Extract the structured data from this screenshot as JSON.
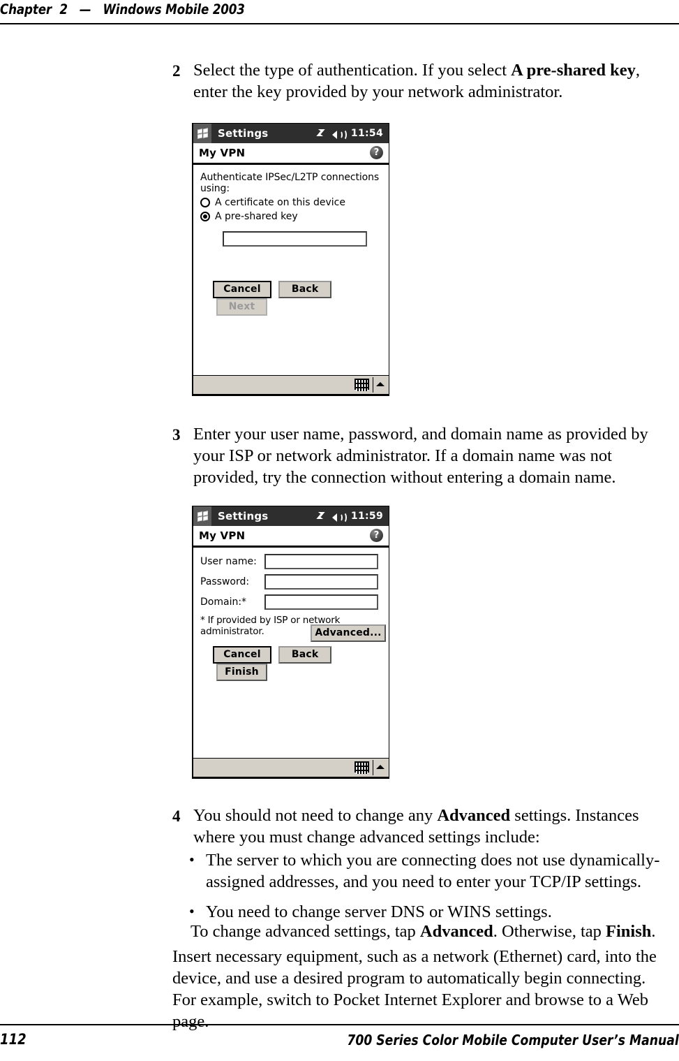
{
  "header": {
    "text": "Chapter  2   —   Windows Mobile 2003"
  },
  "footer": {
    "page_number": "112",
    "manual_title": "700 Series Color Mobile Computer User’s Manual"
  },
  "steps": {
    "step2": {
      "number": "2",
      "part1": "Select the type of authentication. If you select ",
      "bold1": "A pre-shared key",
      "part2": ", enter the key provided by your network administrator."
    },
    "step3": {
      "number": "3",
      "text": "Enter your user name, password, and domain name as provided by your ISP or network administrator. If a domain name was not provided, try the connection without entering a domain name."
    },
    "step4": {
      "number": "4",
      "part1": "You should not need to change any ",
      "bold1": "Advanced",
      "part2": " settings. Instances where you must change advanced settings include:"
    }
  },
  "bullets": [
    "The server to which you are connecting does not use dynamically-assigned addresses, and you need to enter your TCP/IP settings.",
    "You need to change server DNS or WINS settings."
  ],
  "tap_note": {
    "part1": "To change advanced settings, tap ",
    "bold1": "Advanced",
    "part2": ". Otherwise, tap ",
    "bold2": "Finish",
    "part3": "."
  },
  "closing_paragraph": "Insert necessary equipment, such as a network (Ethernet) card, into the device, and use a desired program to automatically begin connecting. For example, switch to Pocket Internet Explorer and browse to a Web page.",
  "screenshot1": {
    "title": "Settings",
    "clock": "11:54",
    "subtitle": "My VPN",
    "help_label": "?",
    "prompt": "Authenticate IPSec/L2TP connections using:",
    "radio_options": [
      {
        "label": "A certificate on this device",
        "selected": false
      },
      {
        "label": "A pre-shared key",
        "selected": true
      }
    ],
    "key_field_value": "",
    "buttons": [
      {
        "label": "Cancel",
        "state": "default"
      },
      {
        "label": "Back",
        "state": "normal"
      },
      {
        "label": "Next",
        "state": "disabled"
      }
    ]
  },
  "screenshot2": {
    "title": "Settings",
    "clock": "11:59",
    "subtitle": "My VPN",
    "help_label": "?",
    "fields": [
      {
        "label": "User name:",
        "value": ""
      },
      {
        "label": "Password:",
        "value": ""
      },
      {
        "label": "Domain:*",
        "value": ""
      }
    ],
    "footnote": "* If provided by ISP or network administrator.",
    "advanced_button": "Advanced...",
    "buttons": [
      {
        "label": "Cancel",
        "state": "default"
      },
      {
        "label": "Back",
        "state": "normal"
      },
      {
        "label": "Finish",
        "state": "normal"
      }
    ]
  }
}
